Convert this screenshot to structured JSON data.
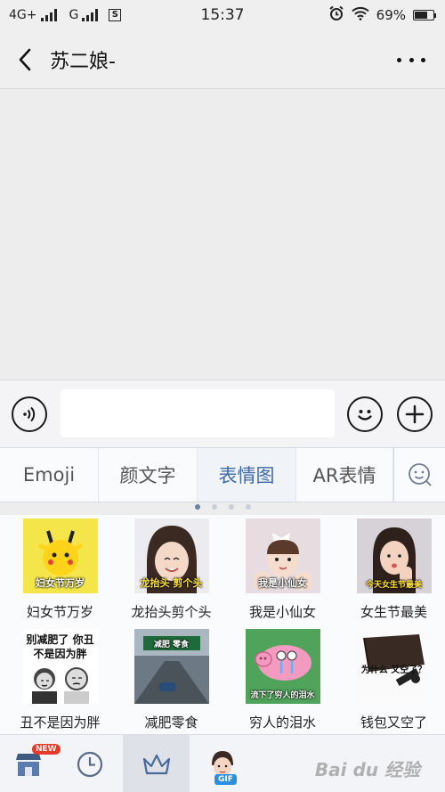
{
  "status_bar": {
    "network_1": "4G+",
    "network_2": "G",
    "sim_badge": "S",
    "time": "15:37",
    "battery": "69%",
    "battery_level": 0.69
  },
  "nav": {
    "title": "苏二娘-"
  },
  "input": {
    "value": "",
    "placeholder": ""
  },
  "emoji_tabs": [
    {
      "label": "Emoji",
      "active": false
    },
    {
      "label": "颜文字",
      "active": false
    },
    {
      "label": "表情图",
      "active": true
    },
    {
      "label": "AR表情",
      "active": false
    }
  ],
  "page_indicator": {
    "count": 4,
    "active": 0
  },
  "stickers": [
    {
      "label": "妇女节万岁",
      "caption": "妇女节万岁"
    },
    {
      "label": "龙抬头剪个头",
      "caption": "龙抬头 剪个头"
    },
    {
      "label": "我是小仙女",
      "caption": "我是小仙女"
    },
    {
      "label": "女生节最美",
      "caption": "今天女生节最美"
    },
    {
      "label": "丑不是因为胖",
      "caption": "别减肥了 你丑不是因为胖"
    },
    {
      "label": "减肥零食",
      "caption": "减肥 零食"
    },
    {
      "label": "穷人的泪水",
      "caption": "流下了穷人的泪水"
    },
    {
      "label": "钱包又空了",
      "caption": "为什么 又空了？"
    }
  ],
  "bottom_bar": {
    "new_badge": "NEW",
    "gif_badge": "GIF",
    "watermark": "Bai du 经验"
  }
}
